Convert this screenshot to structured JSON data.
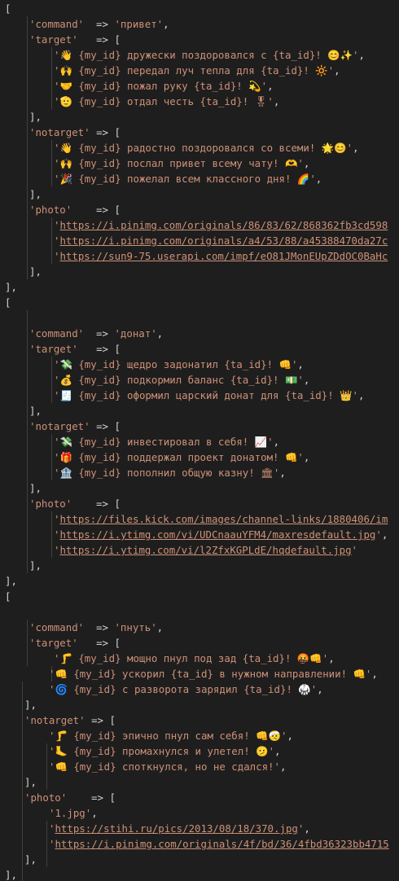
{
  "editor": {
    "lines": [
      {
        "indent": 0,
        "tokens": [
          {
            "t": "br",
            "v": "["
          }
        ]
      },
      {
        "indent": 1,
        "tokens": [
          {
            "t": "str",
            "v": "'command'"
          },
          {
            "t": "op",
            "v": "  => "
          },
          {
            "t": "str",
            "v": "'привет'"
          },
          {
            "t": "op",
            "v": ","
          }
        ]
      },
      {
        "indent": 1,
        "tokens": [
          {
            "t": "str",
            "v": "'target'"
          },
          {
            "t": "op",
            "v": "   => "
          },
          {
            "t": "br",
            "v": "["
          }
        ]
      },
      {
        "indent": 2,
        "tokens": [
          {
            "t": "str",
            "v": "'👋 {my_id} дружески поздоровался с {ta_id}! 😊✨'"
          },
          {
            "t": "op",
            "v": ","
          }
        ]
      },
      {
        "indent": 2,
        "tokens": [
          {
            "t": "str",
            "v": "'🙌 {my_id} передал луч тепла для {ta_id}! 🔆'"
          },
          {
            "t": "op",
            "v": ","
          }
        ]
      },
      {
        "indent": 2,
        "tokens": [
          {
            "t": "str",
            "v": "'🤝 {my_id} пожал руку {ta_id}! 💫'"
          },
          {
            "t": "op",
            "v": ","
          }
        ]
      },
      {
        "indent": 2,
        "tokens": [
          {
            "t": "str",
            "v": "'🫡 {my_id} отдал честь {ta_id}! 🎖'"
          },
          {
            "t": "op",
            "v": ","
          }
        ]
      },
      {
        "indent": 1,
        "tokens": [
          {
            "t": "br",
            "v": "]"
          },
          {
            "t": "op",
            "v": ","
          }
        ]
      },
      {
        "indent": 1,
        "tokens": [
          {
            "t": "str",
            "v": "'notarget'"
          },
          {
            "t": "op",
            "v": " => "
          },
          {
            "t": "br",
            "v": "["
          }
        ]
      },
      {
        "indent": 2,
        "tokens": [
          {
            "t": "str",
            "v": "'👋 {my_id} радостно поздоровался со всеми! 🌟😊'"
          },
          {
            "t": "op",
            "v": ","
          }
        ]
      },
      {
        "indent": 2,
        "tokens": [
          {
            "t": "str",
            "v": "'🙌 {my_id} послал привет всему чату! 🫶'"
          },
          {
            "t": "op",
            "v": ","
          }
        ]
      },
      {
        "indent": 2,
        "tokens": [
          {
            "t": "str",
            "v": "'🎉 {my_id} пожелал всем классного дня! 🌈'"
          },
          {
            "t": "op",
            "v": ","
          }
        ]
      },
      {
        "indent": 1,
        "tokens": [
          {
            "t": "br",
            "v": "]"
          },
          {
            "t": "op",
            "v": ","
          }
        ]
      },
      {
        "indent": 1,
        "tokens": [
          {
            "t": "str",
            "v": "'photo'"
          },
          {
            "t": "op",
            "v": "    => "
          },
          {
            "t": "br",
            "v": "["
          }
        ]
      },
      {
        "indent": 2,
        "tokens": [
          {
            "t": "str",
            "v": "'"
          },
          {
            "t": "url",
            "v": "https://i.pinimg.com/originals/86/83/62/868362fb3cd598"
          }
        ]
      },
      {
        "indent": 2,
        "tokens": [
          {
            "t": "str",
            "v": "'"
          },
          {
            "t": "url",
            "v": "https://i.pinimg.com/originals/a4/53/88/a45388470da27c"
          }
        ]
      },
      {
        "indent": 2,
        "tokens": [
          {
            "t": "str",
            "v": "'"
          },
          {
            "t": "url",
            "v": "https://sun9-75.userapi.com/impf/eO81JMonEUpZDdOC0BaHc"
          }
        ]
      },
      {
        "indent": 1,
        "tokens": [
          {
            "t": "br",
            "v": "]"
          },
          {
            "t": "op",
            "v": ","
          }
        ]
      },
      {
        "indent": 0,
        "tokens": [
          {
            "t": "br",
            "v": "]"
          },
          {
            "t": "op",
            "v": ","
          }
        ]
      },
      {
        "indent": 0,
        "tokens": [
          {
            "t": "br",
            "v": "["
          }
        ]
      },
      {
        "indent": 0,
        "tokens": []
      },
      {
        "indent": 1,
        "tokens": [
          {
            "t": "str",
            "v": "'command'"
          },
          {
            "t": "op",
            "v": "  => "
          },
          {
            "t": "str",
            "v": "'донат'"
          },
          {
            "t": "op",
            "v": ","
          }
        ]
      },
      {
        "indent": 1,
        "tokens": [
          {
            "t": "str",
            "v": "'target'"
          },
          {
            "t": "op",
            "v": "   => "
          },
          {
            "t": "br",
            "v": "["
          }
        ]
      },
      {
        "indent": 2,
        "tokens": [
          {
            "t": "str",
            "v": "'💸 {my_id} щедро задонатил {ta_id}! 👊'"
          },
          {
            "t": "op",
            "v": ","
          }
        ]
      },
      {
        "indent": 2,
        "tokens": [
          {
            "t": "str",
            "v": "'💰 {my_id} подкормил баланс {ta_id}! 💵'"
          },
          {
            "t": "op",
            "v": ","
          }
        ]
      },
      {
        "indent": 2,
        "tokens": [
          {
            "t": "str",
            "v": "'🧾 {my_id} оформил царский донат для {ta_id}! 👑'"
          },
          {
            "t": "op",
            "v": ","
          }
        ]
      },
      {
        "indent": 1,
        "tokens": [
          {
            "t": "br",
            "v": "]"
          },
          {
            "t": "op",
            "v": ","
          }
        ]
      },
      {
        "indent": 1,
        "tokens": [
          {
            "t": "str",
            "v": "'notarget'"
          },
          {
            "t": "op",
            "v": " => "
          },
          {
            "t": "br",
            "v": "["
          }
        ]
      },
      {
        "indent": 2,
        "tokens": [
          {
            "t": "str",
            "v": "'💸 {my_id} инвестировал в себя! 📈'"
          },
          {
            "t": "op",
            "v": ","
          }
        ]
      },
      {
        "indent": 2,
        "tokens": [
          {
            "t": "str",
            "v": "'🎁 {my_id} поддержал проект донатом! 👊'"
          },
          {
            "t": "op",
            "v": ","
          }
        ]
      },
      {
        "indent": 2,
        "tokens": [
          {
            "t": "str",
            "v": "'🏦 {my_id} пополнил общую казну! 🏛'"
          },
          {
            "t": "op",
            "v": ","
          }
        ]
      },
      {
        "indent": 1,
        "tokens": [
          {
            "t": "br",
            "v": "]"
          },
          {
            "t": "op",
            "v": ","
          }
        ]
      },
      {
        "indent": 1,
        "tokens": [
          {
            "t": "str",
            "v": "'photo'"
          },
          {
            "t": "op",
            "v": "    => "
          },
          {
            "t": "br",
            "v": "["
          }
        ]
      },
      {
        "indent": 2,
        "tokens": [
          {
            "t": "str",
            "v": "'"
          },
          {
            "t": "url",
            "v": "https://files.kick.com/images/channel-links/1880406/im"
          }
        ]
      },
      {
        "indent": 2,
        "tokens": [
          {
            "t": "str",
            "v": "'"
          },
          {
            "t": "url",
            "v": "https://i.ytimg.com/vi/UDCnaauYFM4/maxresdefault.jpg"
          },
          {
            "t": "str",
            "v": "'"
          },
          {
            "t": "op",
            "v": ","
          }
        ]
      },
      {
        "indent": 2,
        "tokens": [
          {
            "t": "str",
            "v": "'"
          },
          {
            "t": "url",
            "v": "https://i.ytimg.com/vi/l2ZfxKGPLdE/hqdefault.jpg"
          },
          {
            "t": "str",
            "v": "'"
          }
        ]
      },
      {
        "indent": 1,
        "tokens": [
          {
            "t": "br",
            "v": "]"
          },
          {
            "t": "op",
            "v": ","
          }
        ]
      },
      {
        "indent": 0,
        "tokens": [
          {
            "t": "br",
            "v": "]"
          },
          {
            "t": "op",
            "v": ","
          }
        ]
      },
      {
        "indent": 0,
        "tokens": [
          {
            "t": "br",
            "v": "["
          }
        ]
      },
      {
        "indent": 0,
        "tokens": []
      },
      {
        "indent": 1,
        "tokens": [
          {
            "t": "str",
            "v": "'command'"
          },
          {
            "t": "op",
            "v": "  => "
          },
          {
            "t": "str",
            "v": "'пнуть'"
          },
          {
            "t": "op",
            "v": ","
          }
        ]
      },
      {
        "indent": 1,
        "tokens": [
          {
            "t": "str",
            "v": "'target'"
          },
          {
            "t": "op",
            "v": "   => "
          },
          {
            "t": "br",
            "v": "["
          }
        ]
      },
      {
        "indent": 2,
        "tokens": [
          {
            "t": "str",
            "v": "'🦵 {my_id} мощно пнул под зад {ta_id}! 🤬👊'"
          },
          {
            "t": "op",
            "v": ","
          }
        ]
      },
      {
        "indent": 1.8,
        "tokens": [
          {
            "t": "str",
            "v": "'👊 {my_id} ускорил {ta_id} в нужном направлении! 👊'"
          },
          {
            "t": "op",
            "v": ","
          }
        ]
      },
      {
        "indent": 1.8,
        "tokens": [
          {
            "t": "str",
            "v": "'🌀 {my_id} с разворота зарядил {ta_id}! 🥋'"
          },
          {
            "t": "op",
            "v": ","
          }
        ]
      },
      {
        "indent": 0.8,
        "tokens": [
          {
            "t": "br",
            "v": "]"
          },
          {
            "t": "op",
            "v": ","
          }
        ]
      },
      {
        "indent": 0.8,
        "tokens": [
          {
            "t": "str",
            "v": "'notarget'"
          },
          {
            "t": "op",
            "v": " => "
          },
          {
            "t": "br",
            "v": "["
          }
        ]
      },
      {
        "indent": 1.8,
        "tokens": [
          {
            "t": "str",
            "v": "'🦵 {my_id} эпично пнул сам себя! 👊🤕'"
          },
          {
            "t": "op",
            "v": ","
          }
        ]
      },
      {
        "indent": 1.8,
        "tokens": [
          {
            "t": "str",
            "v": "'🦶 {my_id} промахнулся и улетел! 🫤'"
          },
          {
            "t": "op",
            "v": ","
          }
        ]
      },
      {
        "indent": 1.8,
        "tokens": [
          {
            "t": "str",
            "v": "'👊 {my_id} споткнулся, но не сдался!'"
          },
          {
            "t": "op",
            "v": ","
          }
        ]
      },
      {
        "indent": 0.8,
        "tokens": [
          {
            "t": "br",
            "v": "]"
          },
          {
            "t": "op",
            "v": ","
          }
        ]
      },
      {
        "indent": 0.8,
        "tokens": [
          {
            "t": "str",
            "v": "'photo'"
          },
          {
            "t": "op",
            "v": "    => "
          },
          {
            "t": "br",
            "v": "["
          }
        ]
      },
      {
        "indent": 1.8,
        "tokens": [
          {
            "t": "str",
            "v": "'1.jpg'"
          },
          {
            "t": "op",
            "v": ","
          }
        ]
      },
      {
        "indent": 1.8,
        "tokens": [
          {
            "t": "str",
            "v": "'"
          },
          {
            "t": "url",
            "v": "https://stihi.ru/pics/2013/08/18/370.jpg"
          },
          {
            "t": "str",
            "v": "'"
          },
          {
            "t": "op",
            "v": ","
          }
        ]
      },
      {
        "indent": 1.8,
        "tokens": [
          {
            "t": "str",
            "v": "'"
          },
          {
            "t": "url",
            "v": "https://i.pinimg.com/originals/4f/bd/36/4fbd36323bb4715"
          }
        ]
      },
      {
        "indent": 0.8,
        "tokens": [
          {
            "t": "br",
            "v": "]"
          },
          {
            "t": "op",
            "v": ","
          }
        ]
      },
      {
        "indent": 0,
        "tokens": [
          {
            "t": "br",
            "v": "]"
          },
          {
            "t": "op",
            "v": ","
          }
        ]
      },
      {
        "indent": 0,
        "tokens": [
          {
            "t": "cur",
            "v": "r"
          }
        ]
      }
    ]
  },
  "colors": {
    "background": "#1e1e1e",
    "string": "#ce9178",
    "text": "#d4d4d4",
    "indent_guide": "#404040"
  }
}
